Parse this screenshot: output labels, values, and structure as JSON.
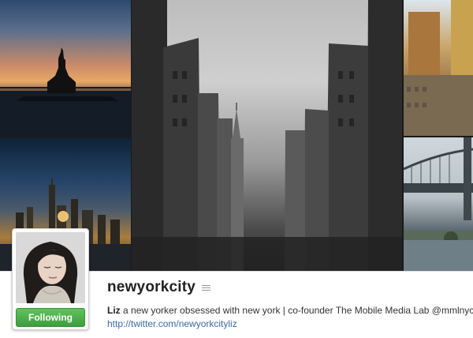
{
  "profile": {
    "username": "newyorkcity",
    "full_name": "Liz",
    "bio": "a new yorker obsessed with new york | co-founder The Mobile Media Lab @mmlnyc",
    "website": "http://twitter.com/newyorkcityliz",
    "follow_label": "Following"
  },
  "colors": {
    "following_green": "#4cae4c",
    "link_blue": "#3b6da0"
  },
  "icons": {
    "profile_menu": "menu-lines-icon"
  }
}
